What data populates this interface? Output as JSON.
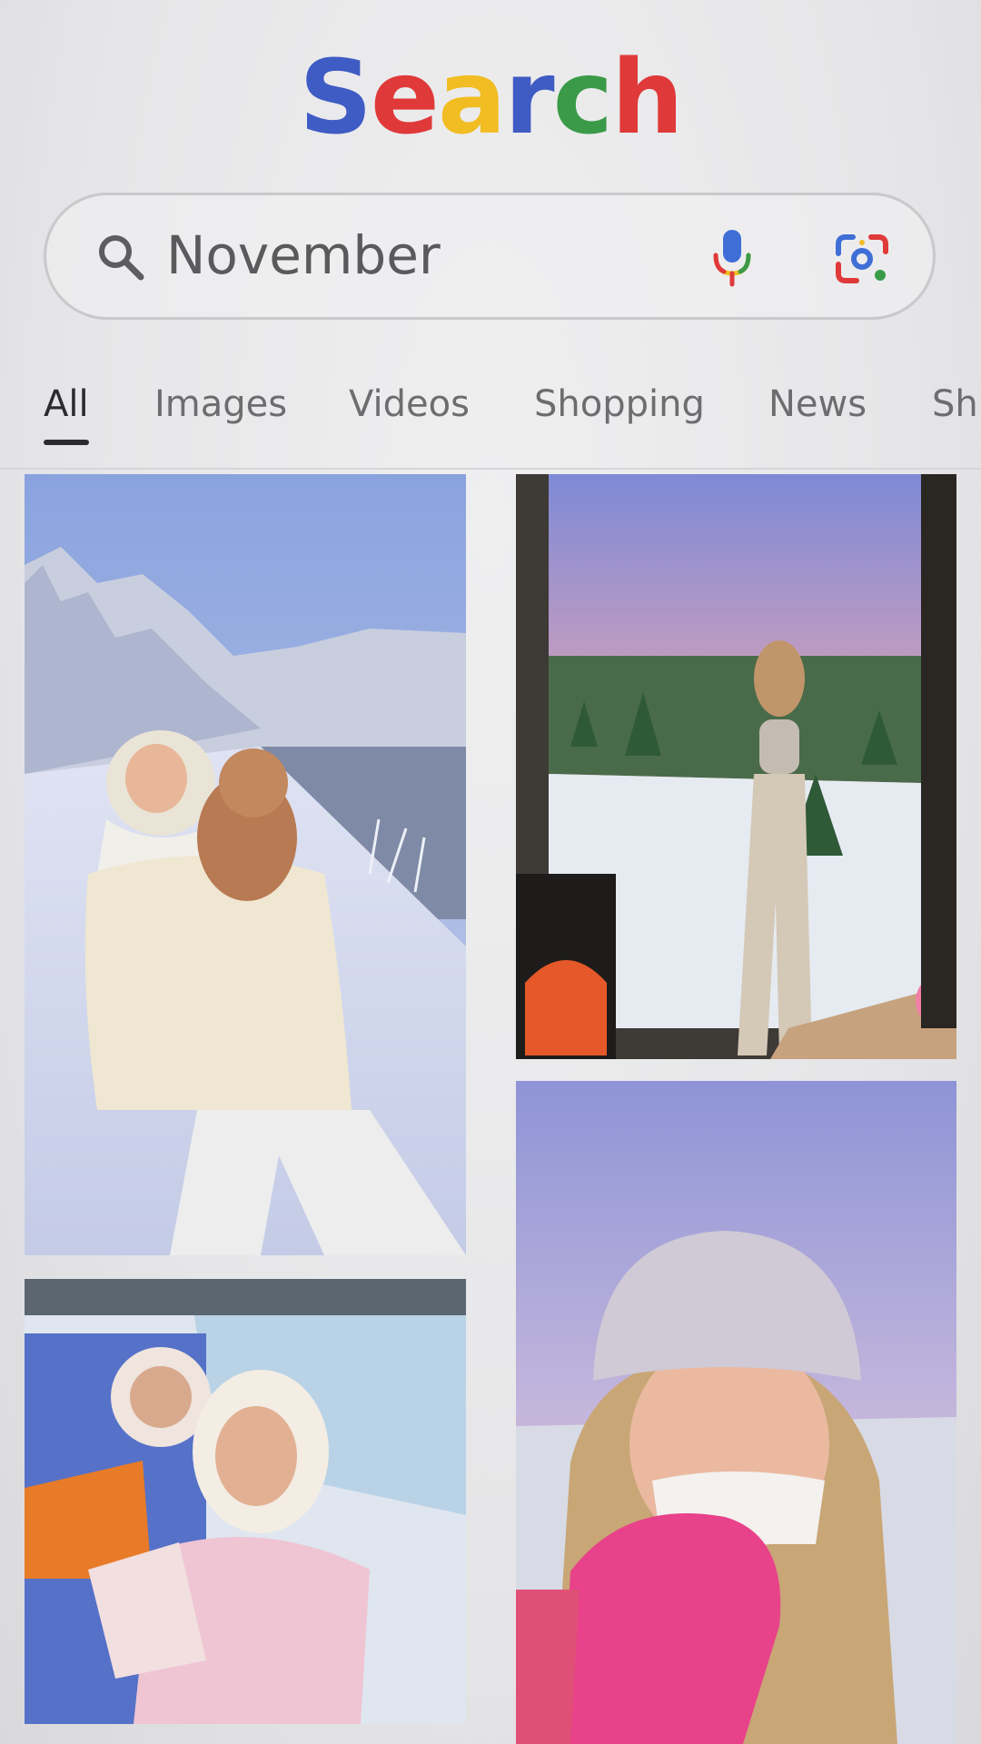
{
  "logo": {
    "letters": [
      "S",
      "e",
      "a",
      "r",
      "c",
      "h"
    ],
    "colors": [
      "#3f5bc4",
      "#e0393a",
      "#f2bd22",
      "#3f5bc4",
      "#3b9a48",
      "#e0393a"
    ]
  },
  "search": {
    "query": "November",
    "icons": [
      "search-icon",
      "mic-icon",
      "lens-icon"
    ]
  },
  "tabs": [
    "All",
    "Images",
    "Videos",
    "Shopping",
    "News",
    "Sh"
  ],
  "active_tab": "All",
  "images": [
    {
      "subject": "woman-holding-puppy-in-snow"
    },
    {
      "subject": "woman-at-window-sunset-forest"
    },
    {
      "subject": "two-women-hugging-earmuffs"
    },
    {
      "subject": "woman-knit-hat-pink-mittens"
    }
  ],
  "colors": {
    "background": "#e7e7e9",
    "text_primary": "#2c2c2e",
    "text_secondary": "#6d6d70"
  }
}
